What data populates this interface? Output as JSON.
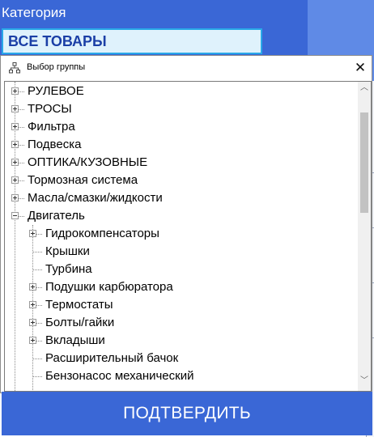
{
  "background": {
    "category_label": "Категория",
    "category_value": "ВСЕ ТОВАРЫ"
  },
  "dialog": {
    "title": "Выбор группы",
    "title_icon": "network-tree-icon",
    "close_icon": "close-icon",
    "tree": [
      {
        "label": "РУЛЕВОЕ",
        "level": 0,
        "expander": "plus"
      },
      {
        "label": "ТРОСЫ",
        "level": 0,
        "expander": "plus"
      },
      {
        "label": "Фильтра",
        "level": 0,
        "expander": "plus"
      },
      {
        "label": "Подвеска",
        "level": 0,
        "expander": "plus"
      },
      {
        "label": "ОПТИКА/КУЗОВНЫЕ",
        "level": 0,
        "expander": "plus"
      },
      {
        "label": "Тормозная система",
        "level": 0,
        "expander": "plus"
      },
      {
        "label": "Масла/смазки/жидкости",
        "level": 0,
        "expander": "plus"
      },
      {
        "label": "Двигатель",
        "level": 0,
        "expander": "minus"
      },
      {
        "label": "Гидрокомпенсаторы",
        "level": 1,
        "expander": "plus"
      },
      {
        "label": "Крышки",
        "level": 1,
        "expander": "none"
      },
      {
        "label": "Турбина",
        "level": 1,
        "expander": "none"
      },
      {
        "label": "Подушки карбюратора",
        "level": 1,
        "expander": "plus"
      },
      {
        "label": "Термостаты",
        "level": 1,
        "expander": "plus"
      },
      {
        "label": "Болты/гайки",
        "level": 1,
        "expander": "plus"
      },
      {
        "label": "Вкладыши",
        "level": 1,
        "expander": "plus"
      },
      {
        "label": "Расширительный бачок",
        "level": 1,
        "expander": "none"
      },
      {
        "label": "Бензонасос механический",
        "level": 1,
        "expander": "none"
      }
    ],
    "scroll_up_icon": "chevron-up-icon",
    "scroll_down_icon": "chevron-down-icon"
  },
  "confirm_label": "ПОДТВЕРДИТЬ"
}
